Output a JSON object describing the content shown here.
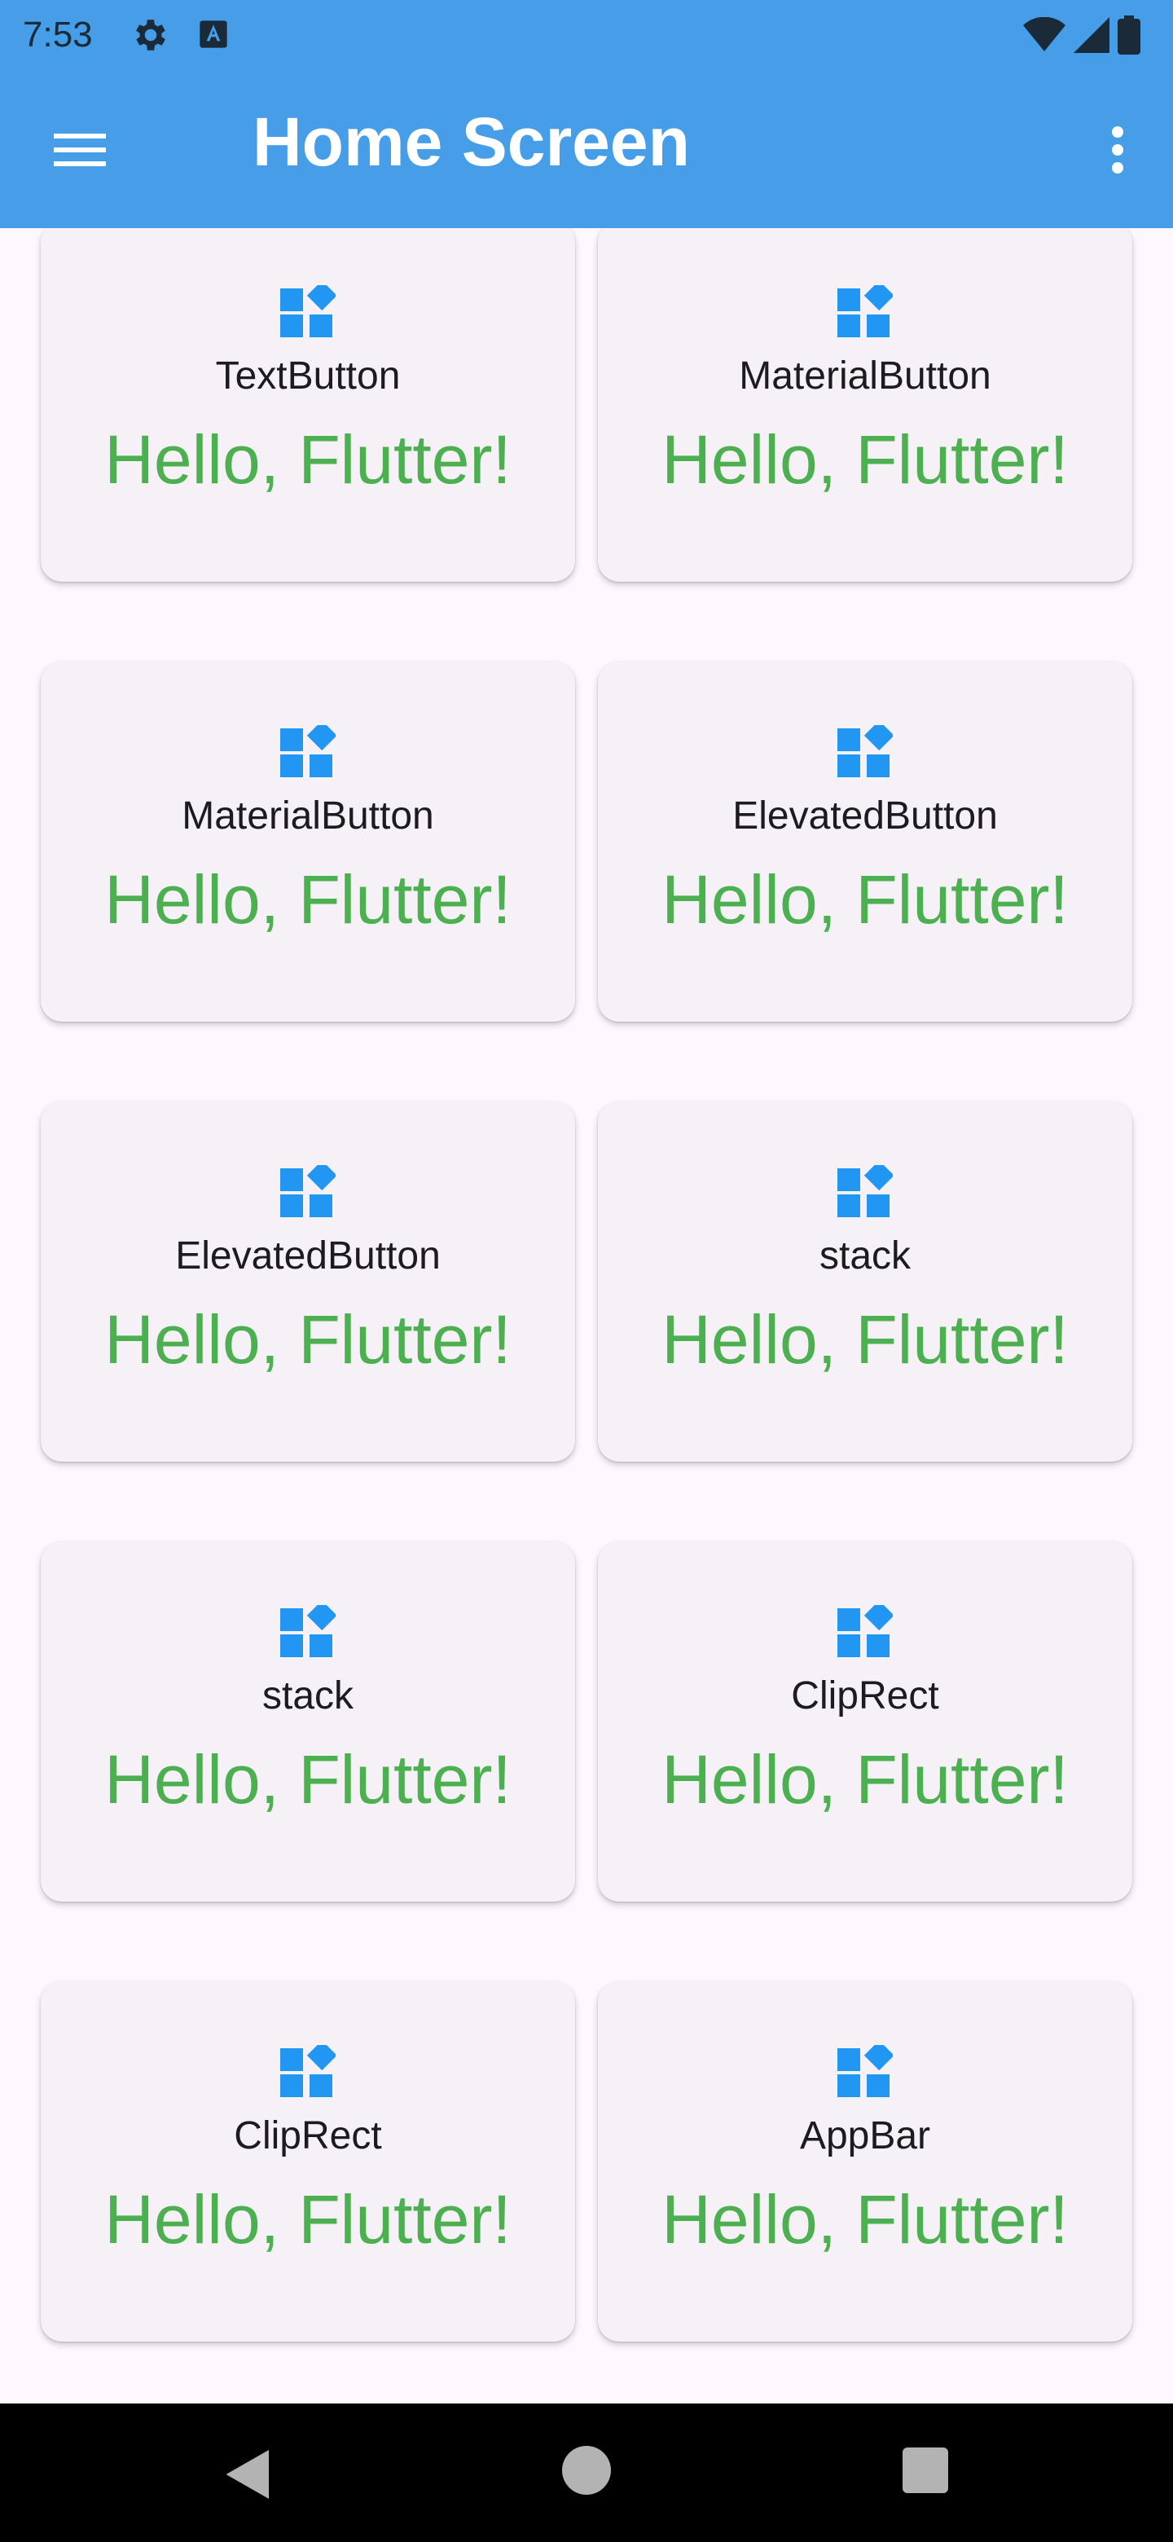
{
  "status_bar": {
    "time": "7:53",
    "icons": [
      "gear-icon",
      "text-a-icon",
      "wifi-icon",
      "signal-icon",
      "battery-icon"
    ]
  },
  "app_bar": {
    "title": "Home Screen",
    "menu_icon": "hamburger-menu-icon",
    "more_icon": "more-vert-icon",
    "background": "#469ee9"
  },
  "cards": [
    {
      "label": "TextButton",
      "text": "Hello, Flutter!"
    },
    {
      "label": "MaterialButton",
      "text": "Hello, Flutter!"
    },
    {
      "label": "MaterialButton",
      "text": "Hello, Flutter!"
    },
    {
      "label": "ElevatedButton",
      "text": "Hello, Flutter!"
    },
    {
      "label": "ElevatedButton",
      "text": "Hello, Flutter!"
    },
    {
      "label": "stack",
      "text": "Hello, Flutter!"
    },
    {
      "label": "stack",
      "text": "Hello, Flutter!"
    },
    {
      "label": "ClipRect",
      "text": "Hello, Flutter!"
    },
    {
      "label": "ClipRect",
      "text": "Hello, Flutter!"
    },
    {
      "label": "AppBar",
      "text": "Hello, Flutter!"
    }
  ],
  "colors": {
    "accent": "#469ee9",
    "icon": "#2196f3",
    "hello_text": "#4caf50"
  },
  "nav_bar": {
    "back_icon": "back-triangle-icon",
    "home_icon": "home-circle-icon",
    "recents_icon": "recents-square-icon"
  }
}
